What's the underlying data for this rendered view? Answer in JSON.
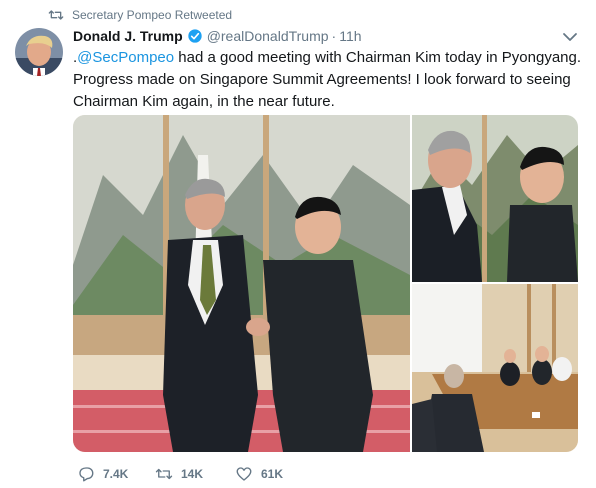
{
  "retweet": {
    "label": "Secretary Pompeo Retweeted",
    "icon": "retweet-icon"
  },
  "tweet": {
    "author_name": "Donald J. Trump",
    "handle": "@realDonaldTrump",
    "separator": "·",
    "time": "11h",
    "text_prefix": ".",
    "mention": "@SecPompeo",
    "text_body": " had a good meeting with Chairman Kim today in Pyongyang. Progress made on Singapore Summit Agreements! I look forward to seeing Chairman Kim again, in the near future."
  },
  "actions": {
    "reply_count": "7.4K",
    "retweet_count": "14K",
    "like_count": "61K"
  },
  "colors": {
    "link": "#1b95e0",
    "muted": "#657786",
    "verified": "#1da1f2",
    "text": "#14171a"
  }
}
